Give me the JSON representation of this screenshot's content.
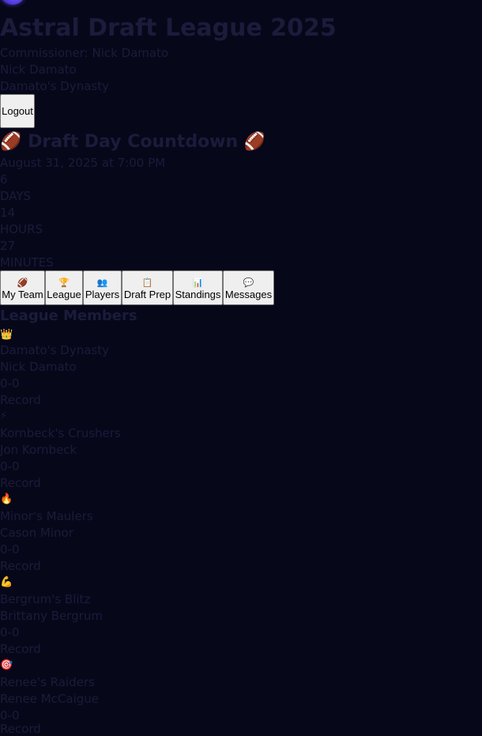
{
  "header": {
    "title": "Astral Draft League 2025",
    "commissioner": "Commissioner: Nick Damato",
    "user_name": "Nick Damato",
    "team_name": "Damato's Dynasty",
    "logout_label": "Logout"
  },
  "countdown": {
    "title": "Draft Day Countdown",
    "left_icon": "football-icon",
    "right_icon": "football-icon",
    "date": "August 31, 2025 at 7:00 PM",
    "days_value": "6",
    "days_label": "DAYS",
    "hours_value": "14",
    "hours_label": "HOURS",
    "minutes_value": "27",
    "minutes_label": "MINUTES"
  },
  "nav": {
    "items": [
      {
        "label": "My Team",
        "icon": "football-icon",
        "glyph": "🏈"
      },
      {
        "label": "League",
        "icon": "trophy-icon",
        "glyph": "🏆"
      },
      {
        "label": "Players",
        "icon": "people-icon",
        "glyph": "👥"
      },
      {
        "label": "Draft Prep",
        "icon": "clipboard-icon",
        "glyph": "📋"
      },
      {
        "label": "Standings",
        "icon": "bar-chart-icon",
        "glyph": "📊"
      },
      {
        "label": "Messages",
        "icon": "speech-bubble-icon",
        "glyph": "💬"
      }
    ]
  },
  "members": {
    "title": "League Members",
    "list": [
      {
        "icon": "crown-icon",
        "glyph": "👑",
        "team": "Damato's Dynasty",
        "owner": "Nick Damato",
        "record": "0-0",
        "record_label": "Record"
      },
      {
        "icon": "lightning-icon",
        "glyph": "⚡",
        "team": "Kornbeck's Crushers",
        "owner": "Jon Kornbeck",
        "record": "0-0",
        "record_label": "Record"
      },
      {
        "icon": "fire-icon",
        "glyph": "🔥",
        "team": "Minor's Maulers",
        "owner": "Cason Minor",
        "record": "0-0",
        "record_label": "Record"
      },
      {
        "icon": "flexed-bicep-icon",
        "glyph": "💪",
        "team": "Bergrum's Blitz",
        "owner": "Brittany Bergrum",
        "record": "0-0",
        "record_label": "Record"
      },
      {
        "icon": "target-icon",
        "glyph": "🎯",
        "team": "Renee's Raiders",
        "owner": "Renee McCaigue",
        "record": "0-0",
        "record_label": "Record"
      }
    ]
  }
}
